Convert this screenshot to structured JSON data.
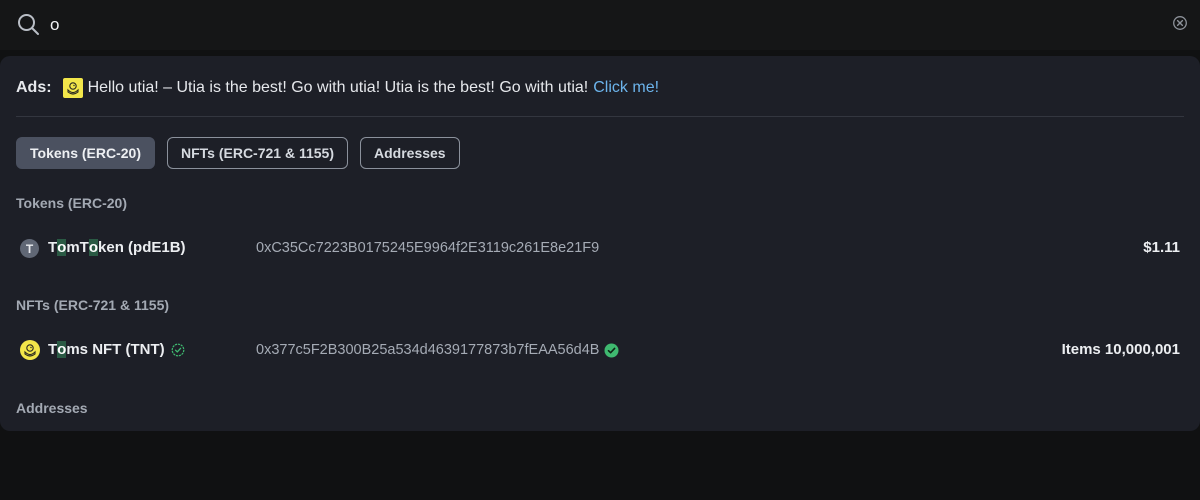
{
  "search": {
    "value": "o"
  },
  "ads": {
    "label": "Ads:",
    "text": "Hello utia! – Utia is the best! Go with utia! Utia is the best! Go with utia!",
    "link_text": "Click me!"
  },
  "tabs": [
    {
      "label": "Tokens (ERC-20)",
      "active": true
    },
    {
      "label": "NFTs (ERC-721 & 1155)",
      "active": false
    },
    {
      "label": "Addresses",
      "active": false
    }
  ],
  "sections": {
    "tokens": {
      "title": "Tokens (ERC-20)",
      "items": [
        {
          "icon_letter": "T",
          "name_parts": [
            "T",
            "o",
            "mT",
            "o",
            "ken (pdE1B)"
          ],
          "address": "0xC35Cc7223B0175245E9964f2E3119c261E8e21F9",
          "value": "$1.11"
        }
      ]
    },
    "nfts": {
      "title": "NFTs (ERC-721 & 1155)",
      "items": [
        {
          "name_parts": [
            "T",
            "o",
            "ms NFT (TNT)"
          ],
          "address": "0x377c5F2B300B25a534d4639177873b7fEAA56d4B",
          "value": "Items 10,000,001",
          "verified": true
        }
      ]
    },
    "addresses": {
      "title": "Addresses"
    }
  },
  "colors": {
    "highlight": "#2a5a44",
    "verified": "#3fb970",
    "link": "#6cb4ec",
    "accent_yellow": "#f2e64a"
  },
  "icons": [
    "search-icon",
    "clear-icon",
    "duck-logo-icon",
    "token-letter-icon",
    "verified-outline-icon",
    "verified-filled-icon"
  ]
}
